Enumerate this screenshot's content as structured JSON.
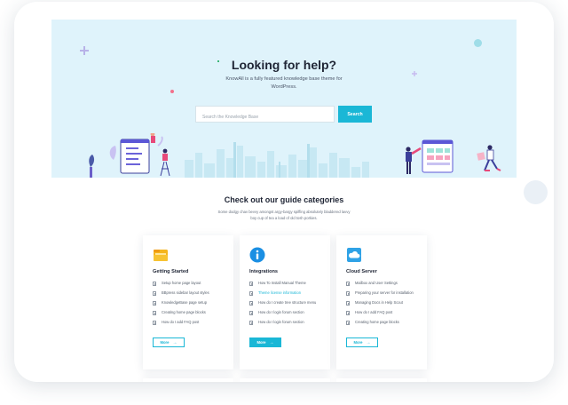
{
  "hero": {
    "title": "Looking for help?",
    "subtitle": "KnowAll is a fully featured knowledge base theme for WordPress.",
    "search_placeholder": "Search the Knowledge Base",
    "search_button": "Search"
  },
  "categories_section": {
    "title": "Check out our guide categories",
    "subtitle": "Some dodgy chav bevvy amongst argy-bargy spiffing absolutely bladdered lavvy boy cup of tea a load of old tosh porkies."
  },
  "cards": [
    {
      "title": "Getting Started",
      "icon": "folder-icon",
      "items": [
        "Setup home page layout",
        "BBpress sidebar layout styles",
        "KnowledgeBase page setup",
        "Creating home page blocks",
        "How do I add FAQ post"
      ],
      "active_item": -1,
      "more_label": "More",
      "more_filled": false
    },
    {
      "title": "Integrations",
      "icon": "info-icon",
      "items": [
        "How To Install Manual Theme",
        "Theme license information",
        "How do I create tree structure menu",
        "How do I login forum section",
        "How do I login forum section"
      ],
      "active_item": 1,
      "more_label": "More",
      "more_filled": true
    },
    {
      "title": "Cloud Server",
      "icon": "cloud-icon",
      "items": [
        "Mailbox and User Settings",
        "Preparing your server for installation",
        "Managing Docs in Help Scout",
        "How do I add FAQ post",
        "Creating home page blocks"
      ],
      "active_item": -1,
      "more_label": "More",
      "more_filled": false
    }
  ],
  "colors": {
    "accent": "#1ab7d6",
    "hero_bg": "#dff3fb",
    "heading": "#1f2535"
  }
}
